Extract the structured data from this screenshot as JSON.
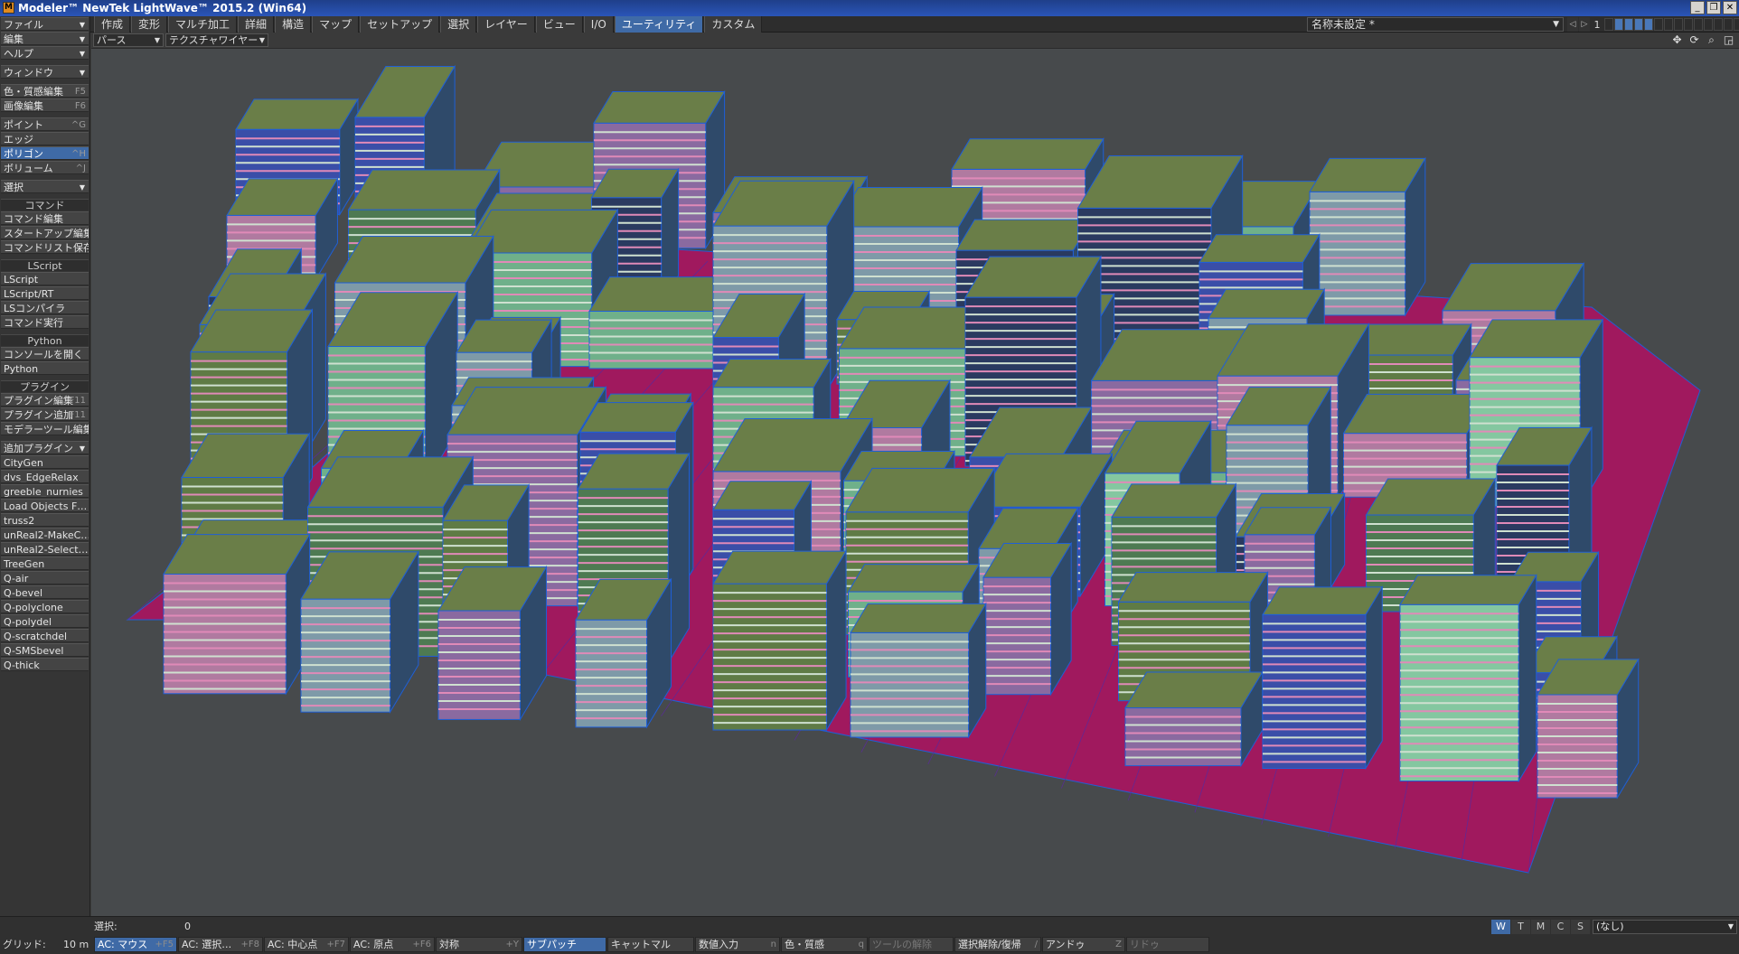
{
  "window": {
    "title": "Modeler™ NewTek LightWave™ 2015.2 (Win64)",
    "buttons": [
      "_",
      "❐",
      "✕"
    ]
  },
  "sidebar": {
    "menus": [
      "ファイル",
      "編集",
      "ヘルプ",
      "ウィンドウ"
    ],
    "editors": [
      {
        "label": "色・質感編集",
        "key": "F5"
      },
      {
        "label": "画像編集",
        "key": "F6"
      }
    ],
    "modes": [
      {
        "label": "ポイント",
        "key": "^G"
      },
      {
        "label": "エッジ",
        "key": ""
      },
      {
        "label": "ポリゴン",
        "key": "^H"
      },
      {
        "label": "ボリューム",
        "key": "^J"
      }
    ],
    "selection_menu": "選択",
    "command_header": "コマンド",
    "command_items": [
      "コマンド編集",
      "スタートアップ編集",
      "コマンドリスト保存"
    ],
    "lscript_header": "LScript",
    "lscript_items": [
      "LScript",
      "LScript/RT",
      "LSコンパイラ",
      "コマンド実行"
    ],
    "python_header": "Python",
    "python_items": [
      "コンソールを開く",
      "Python"
    ],
    "plugin_header": "プラグイン",
    "plugin_items": [
      {
        "label": "プラグイン編集",
        "key": "^F11"
      },
      {
        "label": "プラグイン追加",
        "key": "F11"
      },
      {
        "label": "モデラーツール編集",
        "key": ""
      }
    ],
    "additional_menu": "追加プラグイン",
    "additional_items": [
      "CityGen",
      "dvs_EdgeRelax",
      "greeble_nurnies",
      "Load Objects F…",
      "truss2",
      "unReal2-MakeC…",
      "unReal2-Select…",
      "TreeGen",
      "Q-air",
      "Q-bevel",
      "Q-polyclone",
      "Q-polydel",
      "Q-scratchdel",
      "Q-SMSbevel",
      "Q-thick"
    ]
  },
  "tabs": [
    "作成",
    "変形",
    "マルチ加工",
    "詳細",
    "構造",
    "マップ",
    "セットアップ",
    "選択",
    "レイヤー",
    "ビュー",
    "I/O",
    "ユーティリティ",
    "カスタム"
  ],
  "active_tab": "ユーティリティ",
  "scene": {
    "name": "名称未設定 *",
    "layer_number": "1"
  },
  "viewport": {
    "view": "パース",
    "shading": "テクスチャワイヤー",
    "icons": [
      "move-icon",
      "rotate-icon",
      "zoom-icon",
      "maximize-icon"
    ]
  },
  "status": {
    "selection_label": "選択:",
    "selection_value": "0",
    "grid_label": "グリッド:",
    "grid_value": "10 m",
    "wtmcs": [
      "W",
      "T",
      "M",
      "C",
      "S"
    ],
    "surface": "(なし)"
  },
  "toolbar_bottom": [
    {
      "label": "AC: マウス",
      "key": "+F5",
      "state": "on"
    },
    {
      "label": "AC: 選択…",
      "key": "+F8",
      "state": ""
    },
    {
      "label": "AC: 中心点",
      "key": "+F7",
      "state": ""
    },
    {
      "label": "AC: 原点",
      "key": "+F6",
      "state": ""
    },
    {
      "label": "対称",
      "key": "+Y",
      "state": ""
    },
    {
      "label": "サブパッチ",
      "key": "",
      "state": "on"
    },
    {
      "label": "キャットマル",
      "key": "",
      "state": ""
    },
    {
      "label": "数値入力",
      "key": "n",
      "state": ""
    },
    {
      "label": "色・質感",
      "key": "q",
      "state": ""
    },
    {
      "label": "ツールの解除",
      "key": "",
      "state": "dis"
    },
    {
      "label": "選択解除/復帰",
      "key": "/",
      "state": ""
    },
    {
      "label": "アンドゥ",
      "key": "Z",
      "state": ""
    },
    {
      "label": "リドゥ",
      "key": "",
      "state": "dis"
    }
  ],
  "colors": {
    "accent": "#3f6aa6",
    "ground": "#a0195e",
    "wire": "#1f5fd6"
  }
}
